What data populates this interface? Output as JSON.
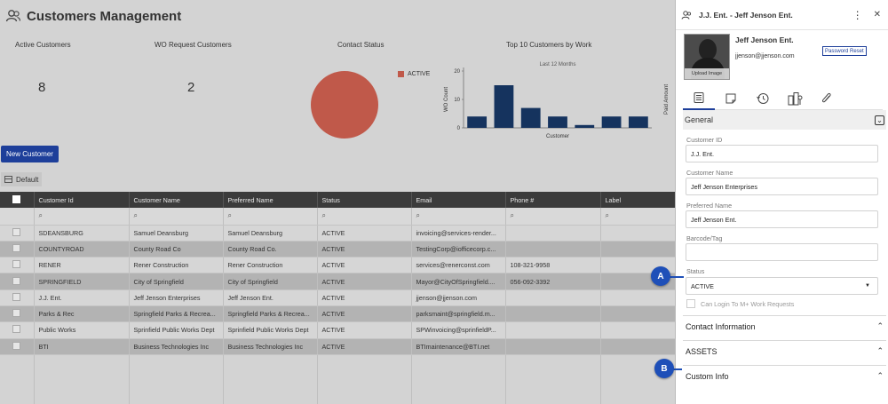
{
  "header": {
    "title": "Customers Management"
  },
  "kpis": [
    {
      "label": "Active Customers",
      "value": "8"
    },
    {
      "label": "WO Request Customers",
      "value": "2"
    },
    {
      "label": "Contact Status",
      "legend": "ACTIVE"
    },
    {
      "label": "Top 10 Customers by Work",
      "subtitle": "Last 12 Months"
    }
  ],
  "colors": {
    "accent": "#1e3f9a",
    "pie": "#c0594a",
    "bar": "#15335e"
  },
  "chart_data": [
    {
      "type": "pie",
      "title": "Contact Status",
      "labels": [
        "ACTIVE"
      ],
      "values": [
        8
      ]
    },
    {
      "type": "bar",
      "title": "Top 10 Customers by Work",
      "subtitle": "Last 12 Months",
      "xlabel": "Customer",
      "ylabel": "WO Count",
      "y2label": "Paid Amount",
      "yticks": [
        0,
        10,
        20
      ],
      "ylim": [
        0,
        20
      ],
      "values": [
        4,
        15,
        7,
        4,
        1,
        4,
        4
      ]
    }
  ],
  "actions": {
    "new_customer": "New Customer",
    "view": "Default"
  },
  "table": {
    "columns": [
      "Customer Id",
      "Customer Name",
      "Preferred Name",
      "Status",
      "Email",
      "Phone #",
      "Label"
    ],
    "rows": [
      [
        "SDEANSBURG",
        "Samuel Deansburg",
        "Samuel Deansburg",
        "ACTIVE",
        "invoicing@services-render...",
        "",
        ""
      ],
      [
        "COUNTYROAD",
        "County Road Co",
        "County Road Co.",
        "ACTIVE",
        "TestingCorp@iofficecorp.c...",
        "",
        ""
      ],
      [
        "RENER",
        "Rener Construction",
        "Rener Construction",
        "ACTIVE",
        "services@renerconst.com",
        "108-321-9958",
        ""
      ],
      [
        "SPRINGFIELD",
        "City of Springfield",
        "City of Springfield",
        "ACTIVE",
        "Mayor@CityOfSpringfield....",
        "056-092-3392",
        ""
      ],
      [
        "J.J. Ent.",
        "Jeff Jenson Enterprises",
        "Jeff Jenson Ent.",
        "ACTIVE",
        "jjenson@jjenson.com",
        "",
        ""
      ],
      [
        "Parks & Rec",
        "Springfield Parks & Recrea...",
        "Springfield Parks & Recrea...",
        "ACTIVE",
        "parksmaint@springfield.m...",
        "",
        ""
      ],
      [
        "Public Works",
        "Sprinfield Public Works Dept",
        "Sprinfield Public Works Dept",
        "ACTIVE",
        "SPWinvoicing@sprinfieldP...",
        "",
        ""
      ],
      [
        "BTI",
        "Business Technologies Inc",
        "Business Technologies Inc",
        "ACTIVE",
        "BTImaintenance@BTI.net",
        "",
        ""
      ]
    ]
  },
  "panel": {
    "title": "J.J. Ent. - Jeff Jenson Ent.",
    "name": "Jeff Jenson Ent.",
    "email": "jjenson@jjenson.com",
    "upload_label": "Upload Image",
    "password_reset": "Password Reset",
    "general": "General",
    "fields": {
      "customer_id_label": "Customer ID",
      "customer_id": "J.J. Ent.",
      "customer_name_label": "Customer Name",
      "customer_name": "Jeff Jenson Enterprises",
      "preferred_name_label": "Preferred Name",
      "preferred_name": "Jeff Jenson Ent.",
      "barcode_label": "Barcode/Tag",
      "barcode": "",
      "status_label": "Status",
      "status": "ACTIVE",
      "login_label": "Can Login To M+ Work Requests"
    },
    "sections": [
      "Contact Information",
      "ASSETS",
      "Custom Info"
    ]
  },
  "markers": [
    "A",
    "B"
  ]
}
